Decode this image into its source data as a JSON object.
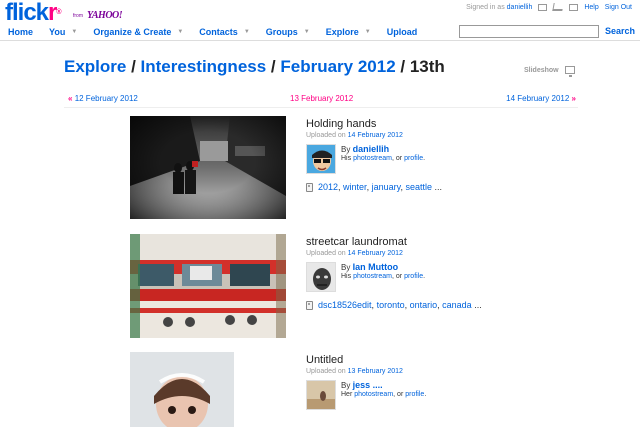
{
  "header": {
    "logo_a": "flick",
    "logo_b": "r",
    "logo_reg": "®",
    "from": "from",
    "yahoo": "YAHOO!",
    "signed_in_prefix": "Signed in as",
    "username": "daniellih",
    "help": "Help",
    "sign_out": "Sign Out"
  },
  "nav": [
    {
      "label": "Home",
      "caret": false
    },
    {
      "label": "You",
      "caret": true
    },
    {
      "label": "Organize & Create",
      "caret": true
    },
    {
      "label": "Contacts",
      "caret": true
    },
    {
      "label": "Groups",
      "caret": true
    },
    {
      "label": "Explore",
      "caret": true
    },
    {
      "label": "Upload",
      "caret": false
    }
  ],
  "search": {
    "value": "",
    "button": "Search"
  },
  "title": {
    "explore": "Explore",
    "sep": " / ",
    "interestingness": "Interestingness",
    "month": "February 2012",
    "day": "13th"
  },
  "slideshow": "Slideshow",
  "datenav": {
    "prev_arrow": "«",
    "prev": "12 February 2012",
    "current": "13 February 2012",
    "next": "14 February 2012",
    "next_arrow": "»"
  },
  "entries": [
    {
      "title": "Holding hands",
      "uploaded_prefix": "Uploaded on",
      "uploaded_date": "14 February 2012",
      "by": "By",
      "owner": "daniellih",
      "pronoun": "His",
      "photostream": "photostream",
      "or": ", or",
      "profile": "profile",
      "tags": [
        "2012",
        "winter",
        "january",
        "seattle"
      ],
      "tags_more": " ..."
    },
    {
      "title": "streetcar laundromat",
      "uploaded_prefix": "Uploaded on",
      "uploaded_date": "14 February 2012",
      "by": "By",
      "owner": "Ian Muttoo",
      "pronoun": "His",
      "photostream": "photostream",
      "or": ", or",
      "profile": "profile",
      "tags": [
        "dsc18526edit",
        "toronto",
        "ontario",
        "canada"
      ],
      "tags_more": " ..."
    },
    {
      "title": "Untitled",
      "uploaded_prefix": "Uploaded on",
      "uploaded_date": "13 February 2012",
      "by": "By",
      "owner": "jess ....",
      "pronoun": "Her",
      "photostream": "photostream",
      "or": ", or",
      "profile": "profile",
      "tags": [],
      "tags_more": ""
    }
  ]
}
